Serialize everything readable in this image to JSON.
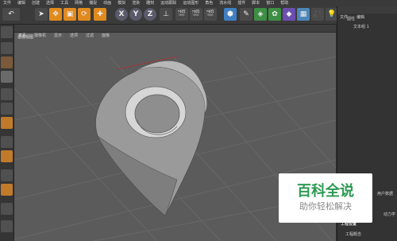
{
  "menu": [
    "文件",
    "编辑",
    "创建",
    "选择",
    "工具",
    "网格",
    "捕捉",
    "动画",
    "模拟",
    "渲染",
    "雕刻",
    "运动跟踪",
    "运动图形",
    "角色",
    "流水线",
    "插件",
    "脚本",
    "窗口",
    "帮助"
  ],
  "toolbar": {
    "axis_x": "X",
    "axis_y": "Y",
    "axis_z": "Z"
  },
  "viewport": {
    "menu": [
      "查看",
      "摄像机",
      "显示",
      "选项",
      "过滤",
      "面板"
    ],
    "label": "透视视图"
  },
  "right_panel": {
    "tabs": [
      "文件",
      "编辑"
    ],
    "object_item": "圆柱",
    "child_item": "文本组 1",
    "attr_tab": "用户数据",
    "attr_tab2": "动力学",
    "project_title": "工程设置",
    "project_row": "工程概念"
  },
  "watermark": {
    "title": "百科全说",
    "subtitle": "助你轻松解决"
  },
  "colors": {
    "brand_green": "#2d9a52",
    "viewport_bg": "#5b5b5b",
    "accent_orange": "#e08a1e"
  }
}
